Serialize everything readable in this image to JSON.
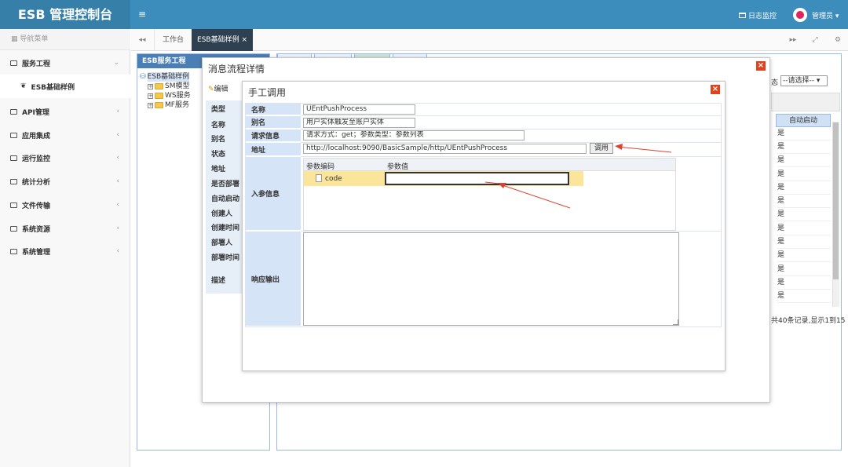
{
  "header": {
    "brand": "ESB 管理控制台",
    "toggle_icon": "≡",
    "monitor_label": "日志监控",
    "user_label": "管理员"
  },
  "sidebar": {
    "nav_title": "导航菜单",
    "menus": [
      {
        "label": "服务工程",
        "arrow": "⌄"
      },
      {
        "label": "API管理",
        "arrow": "‹"
      },
      {
        "label": "应用集成",
        "arrow": "‹"
      },
      {
        "label": "运行监控",
        "arrow": "‹"
      },
      {
        "label": "统计分析",
        "arrow": "‹"
      },
      {
        "label": "文件传输",
        "arrow": "‹"
      },
      {
        "label": "系统资源",
        "arrow": "‹"
      },
      {
        "label": "系统管理",
        "arrow": "‹"
      }
    ],
    "submenu": "ESB基础样例"
  },
  "tabs": {
    "home": "工作台",
    "active": "ESB基础样例",
    "close": "×",
    "prev_icon": "◂◂",
    "next_icon": "▸▸",
    "full_icon": "⤢",
    "gear_icon": "⚙"
  },
  "bg": {
    "tree_title": "ESB服务工程",
    "tree_root": "ESB基础样例",
    "tree_nodes": [
      "SM模型",
      "WS服务",
      "MF服务"
    ],
    "status_label": "态",
    "status_select": "--请选择--",
    "auto_start_header": "自动启动",
    "auto_values": [
      "是",
      "是",
      "是",
      "是",
      "是",
      "是",
      "是",
      "是",
      "是",
      "是",
      "是",
      "是",
      "是"
    ],
    "paging": "共40条记录,显示1到15"
  },
  "dialog_outer": {
    "title": "消息流程详情",
    "edit_label": "编辑",
    "labels": [
      "类型",
      "名称",
      "别名",
      "状态",
      "地址",
      "是否部署",
      "自动启动",
      "创建人",
      "创建时间",
      "部署人",
      "部署时间",
      "描述"
    ]
  },
  "dialog_inner": {
    "title": "手工调用",
    "fields": {
      "name_label": "名称",
      "name_value": "UEntPushProcess",
      "alias_label": "别名",
      "alias_value": "用户实体触发至账户实体",
      "req_label": "请求信息",
      "req_value": "请求方式：get；参数类型：参数列表",
      "addr_label": "地址",
      "addr_value": "http://localhost:9090/BasicSample/http/UEntPushProcess",
      "call_button": "调用",
      "params_label": "入参信息",
      "param_code_header": "参数编码",
      "param_value_header": "参数值",
      "param_code": "code",
      "param_value": "",
      "resp_label": "响应输出",
      "resp_value": ""
    }
  },
  "colors": {
    "header": "#3c8dbc",
    "brand_bg": "#367fa9",
    "active_tab": "#2f4050",
    "close_red": "#e0411f",
    "arrow_red": "#e0412f",
    "label_bg": "#d6e4f7",
    "row_highlight": "#fbe59b"
  }
}
